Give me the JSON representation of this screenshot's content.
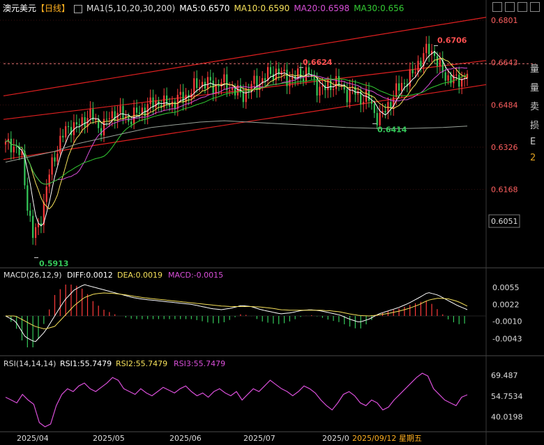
{
  "header": {
    "symbol": "澳元美元",
    "period": "【日线】",
    "ma_label": "MA1(5,10,20,30,200)",
    "ma5": "MA5:0.6570",
    "ma10": "MA10:0.6590",
    "ma20": "MA20:0.6598",
    "ma30": "MA30:0.656"
  },
  "macd_header": {
    "label": "MACD(26,12,9)",
    "diff": "DIFF:0.0012",
    "dea": "DEA:0.0019",
    "macd": "MACD:-0.0015"
  },
  "rsi_header": {
    "label": "RSI(14,14,14)",
    "rsi1": "RSI1:55.7479",
    "rsi2": "RSI2:55.7479",
    "rsi3": "RSI3:55.7479"
  },
  "sidebar": [
    "量",
    "量",
    "卖",
    "损",
    "E",
    "2"
  ],
  "colors": {
    "up": "#ff3b3b",
    "down": "#35c95a",
    "ma5": "#ffffff",
    "ma10": "#f5e05a",
    "ma20": "#d94fd9",
    "ma30": "#33cc33",
    "ma200": "#9aa39a",
    "channel": "#e02020",
    "rsi": "#d94fd9",
    "grid": "#3a1010"
  },
  "chart_data": [
    {
      "type": "candlestick",
      "title": "澳元美元 日线",
      "y_ticks": [
        0.6801,
        0.6643,
        0.6484,
        0.6326,
        0.6168
      ],
      "y_range": [
        0.588,
        0.684
      ],
      "price_box": "0.6051",
      "x_ticks": [
        "2025/04",
        "2025/05",
        "2025/06",
        "2025/07",
        "2025/0",
        "2025/09/12 星期五"
      ],
      "annotations": [
        {
          "label": "0.6706",
          "value": 0.6706,
          "kind": "high"
        },
        {
          "label": "0.6624",
          "value": 0.6624,
          "kind": "high"
        },
        {
          "label": "0.6414",
          "value": 0.6414,
          "kind": "low"
        },
        {
          "label": "0.5913",
          "value": 0.5913,
          "kind": "low"
        }
      ],
      "current_price_line": 0.6638,
      "channel_lines": [
        {
          "name": "upper",
          "start": 0.6518,
          "end": 0.6812
        },
        {
          "name": "middle",
          "start": 0.643,
          "end": 0.665
        },
        {
          "name": "lower",
          "start": 0.628,
          "end": 0.656
        }
      ],
      "close_path": [
        0.633,
        0.634,
        0.632,
        0.628,
        0.611,
        0.599,
        0.603,
        0.612,
        0.623,
        0.63,
        0.635,
        0.639,
        0.641,
        0.64,
        0.642,
        0.645,
        0.643,
        0.64,
        0.641,
        0.644,
        0.646,
        0.645,
        0.643,
        0.644,
        0.645,
        0.647,
        0.648,
        0.649,
        0.65,
        0.648,
        0.649,
        0.65,
        0.651,
        0.652,
        0.654,
        0.656,
        0.657,
        0.656,
        0.655,
        0.657,
        0.656,
        0.655,
        0.653,
        0.652,
        0.654,
        0.656,
        0.657,
        0.658,
        0.66,
        0.661,
        0.66,
        0.659,
        0.658,
        0.659,
        0.66,
        0.661,
        0.657,
        0.655,
        0.654,
        0.656,
        0.657,
        0.655,
        0.653,
        0.654,
        0.652,
        0.651,
        0.651,
        0.646,
        0.643,
        0.646,
        0.65,
        0.653,
        0.656,
        0.658,
        0.659,
        0.664,
        0.667,
        0.669,
        0.668,
        0.662,
        0.659,
        0.659,
        0.657,
        0.658,
        0.661
      ],
      "ma200_path": [
        0.627,
        0.629,
        0.631,
        0.634,
        0.636,
        0.638,
        0.64,
        0.641,
        0.642,
        0.6425,
        0.642,
        0.6415,
        0.641,
        0.6405,
        0.64,
        0.6397,
        0.6395,
        0.6397,
        0.64,
        0.6405
      ]
    },
    {
      "type": "bar",
      "title": "MACD(26,12,9)",
      "y_ticks": [
        0.0055,
        0.0022,
        -0.001,
        -0.0043
      ],
      "y_range": [
        -0.006,
        0.0068
      ],
      "diff_path": [
        0.0,
        -0.001,
        -0.004,
        -0.005,
        -0.003,
        0.0,
        0.003,
        0.005,
        0.006,
        0.0055,
        0.005,
        0.0045,
        0.004,
        0.0035,
        0.0032,
        0.003,
        0.0028,
        0.0026,
        0.0024,
        0.0022,
        0.0018,
        0.0014,
        0.0012,
        0.0015,
        0.002,
        0.0018,
        0.0012,
        0.0008,
        0.0004,
        0.0006,
        0.001,
        0.0012,
        0.001,
        0.0006,
        0.0002,
        -0.0006,
        -0.0012,
        -0.0006,
        0.0004,
        0.001,
        0.0016,
        0.0024,
        0.0034,
        0.0045,
        0.004,
        0.003,
        0.002,
        0.0012
      ],
      "dea_path": [
        0.0,
        0.0,
        -0.001,
        -0.002,
        -0.0025,
        -0.002,
        0.0,
        0.002,
        0.0035,
        0.0042,
        0.0044,
        0.0043,
        0.0041,
        0.0038,
        0.0035,
        0.0033,
        0.0031,
        0.0029,
        0.0027,
        0.0025,
        0.0023,
        0.0021,
        0.0019,
        0.0018,
        0.0018,
        0.0018,
        0.0017,
        0.0015,
        0.0012,
        0.0011,
        0.0011,
        0.0011,
        0.0011,
        0.001,
        0.0008,
        0.0004,
        0.0001,
        0.0,
        0.0002,
        0.0005,
        0.0009,
        0.0014,
        0.0021,
        0.003,
        0.0034,
        0.0033,
        0.0028,
        0.0019
      ]
    },
    {
      "type": "line",
      "title": "RSI(14,14,14)",
      "y_ticks": [
        69.487,
        54.7534,
        40.0198
      ],
      "y_range": [
        30,
        75
      ],
      "rsi_path": [
        54,
        52,
        50,
        56,
        52,
        49,
        36,
        33,
        35,
        48,
        56,
        60,
        58,
        62,
        64,
        60,
        58,
        61,
        64,
        68,
        66,
        60,
        58,
        56,
        60,
        57,
        55,
        58,
        61,
        59,
        57,
        60,
        62,
        58,
        55,
        57,
        54,
        58,
        60,
        57,
        55,
        58,
        52,
        56,
        60,
        58,
        62,
        66,
        63,
        60,
        58,
        55,
        58,
        62,
        60,
        57,
        52,
        48,
        45,
        50,
        56,
        58,
        55,
        50,
        48,
        52,
        50,
        45,
        47,
        52,
        56,
        60,
        64,
        68,
        71,
        69,
        60,
        56,
        52,
        50,
        48,
        54,
        55.7
      ]
    }
  ]
}
